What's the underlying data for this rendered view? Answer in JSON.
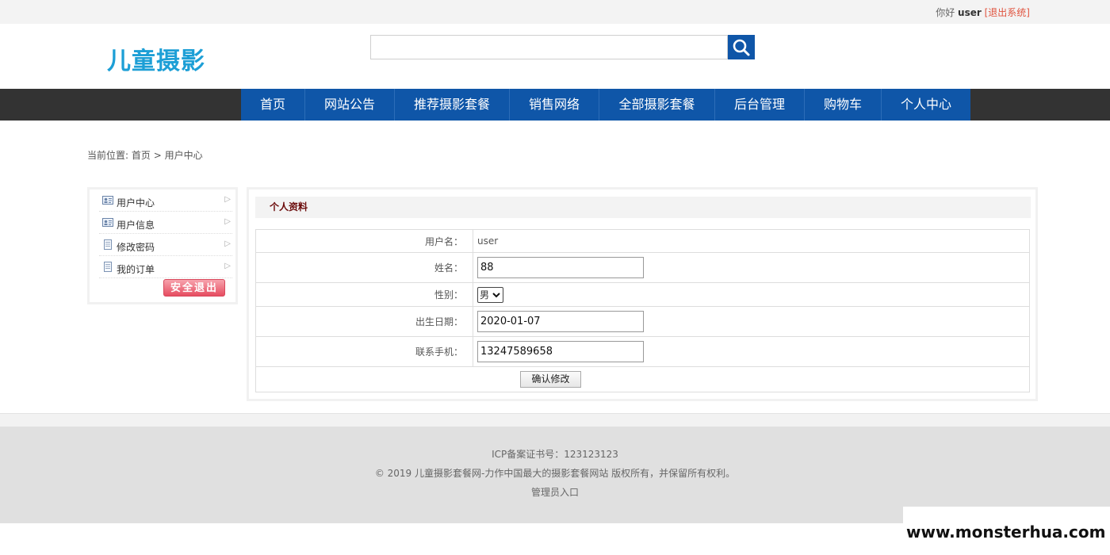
{
  "topbar": {
    "greeting": "你好",
    "username": "user",
    "logout": "[退出系统]"
  },
  "header": {
    "logo": "儿童摄影",
    "search": {
      "value": "",
      "placeholder": ""
    }
  },
  "nav": [
    {
      "label": "首页"
    },
    {
      "label": "网站公告"
    },
    {
      "label": "推荐摄影套餐"
    },
    {
      "label": "销售网络"
    },
    {
      "label": "全部摄影套餐"
    },
    {
      "label": "后台管理"
    },
    {
      "label": "购物车"
    },
    {
      "label": "个人中心"
    }
  ],
  "breadcrumb": {
    "prefix": "当前位置: ",
    "home": "首页",
    "sep": " > ",
    "current": "用户中心"
  },
  "sidebar": {
    "items": [
      {
        "label": "用户中心",
        "icon": "id-card-icon"
      },
      {
        "label": "用户信息",
        "icon": "id-card-icon"
      },
      {
        "label": "修改密码",
        "icon": "document-icon"
      },
      {
        "label": "我的订单",
        "icon": "document-icon"
      }
    ],
    "logout": "安全退出"
  },
  "profile": {
    "title": "个人资料",
    "username_label": "用户名：",
    "username_value": "user",
    "name_label": "姓名：",
    "name_value": "88",
    "gender_label": "性别：",
    "gender_value": "男",
    "birth_label": "出生日期：",
    "birth_value": "2020-01-07",
    "phone_label": "联系手机：",
    "phone_value": "13247589658",
    "submit": "确认修改"
  },
  "footer": {
    "icp": "ICP备案证书号：123123123",
    "copyright": "© 2019 儿童摄影套餐网-力作中国最大的摄影套餐网站 版权所有，并保留所有权利。",
    "admin": "管理员入口"
  },
  "watermark": "www.monsterhua.com",
  "colors": {
    "accent": "#0f56a8",
    "logo": "#1d9fd6",
    "navbar": "#333333",
    "title": "#6b0b0b",
    "logout_btn": "#e64d61"
  }
}
